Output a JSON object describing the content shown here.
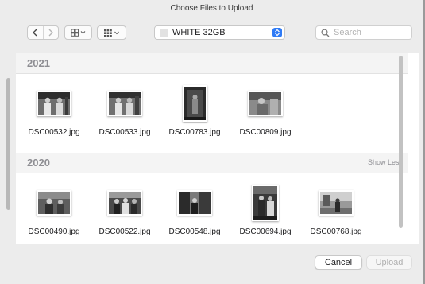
{
  "window": {
    "title": "Choose Files to Upload"
  },
  "toolbar": {
    "back_icon": "chevron-left-icon",
    "forward_icon": "chevron-right-icon",
    "view_icon": "grid-view-icon",
    "group_icon": "group-by-icon",
    "location": "WHITE 32GB",
    "search_placeholder": "Search"
  },
  "sections": [
    {
      "year": "2021",
      "show_less": "",
      "files": [
        {
          "name": "DSC00532.jpg",
          "orientation": "landscape"
        },
        {
          "name": "DSC00533.jpg",
          "orientation": "landscape"
        },
        {
          "name": "DSC00783.jpg",
          "orientation": "portrait"
        },
        {
          "name": "DSC00809.jpg",
          "orientation": "landscape"
        }
      ]
    },
    {
      "year": "2020",
      "show_less": "Show Less",
      "files": [
        {
          "name": "DSC00490.jpg",
          "orientation": "landscape"
        },
        {
          "name": "DSC00522.jpg",
          "orientation": "landscape"
        },
        {
          "name": "DSC00548.jpg",
          "orientation": "landscape"
        },
        {
          "name": "DSC00694.jpg",
          "orientation": "portrait"
        },
        {
          "name": "DSC00768.jpg",
          "orientation": "landscape"
        }
      ]
    }
  ],
  "buttons": {
    "cancel": "Cancel",
    "upload": "Upload"
  },
  "colors": {
    "accent": "#2f7bf6",
    "section_label": "#8e8e93"
  }
}
